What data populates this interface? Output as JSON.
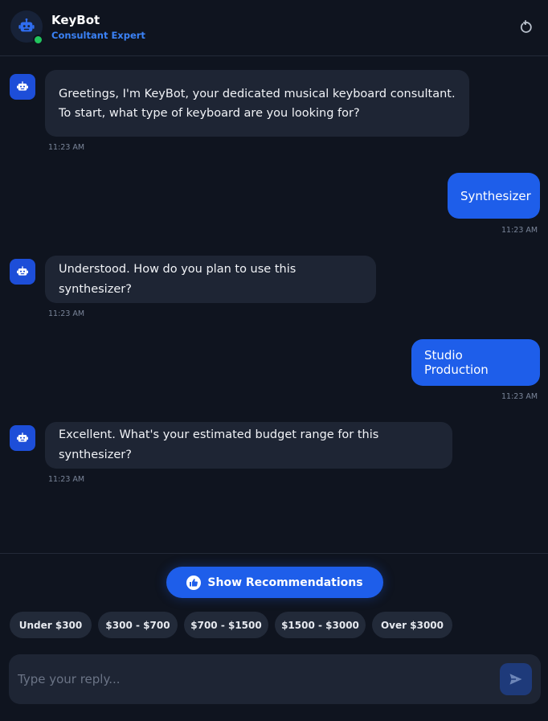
{
  "header": {
    "title": "KeyBot",
    "subtitle": "Consultant Expert"
  },
  "messages": [
    {
      "role": "bot",
      "lines": [
        "Greetings, I'm KeyBot, your dedicated musical keyboard consultant.",
        "To start, what type of keyboard are you looking for?"
      ],
      "time": "11:23 AM"
    },
    {
      "role": "user",
      "text": "Synthesizer",
      "time": "11:23 AM"
    },
    {
      "role": "bot",
      "lines": [
        "Understood. How do you plan to use this synthesizer?"
      ],
      "time": "11:23 AM"
    },
    {
      "role": "user",
      "text": "Studio Production",
      "time": "11:23 AM"
    },
    {
      "role": "bot",
      "lines": [
        "Excellent. What's your estimated budget range for this synthesizer?"
      ],
      "time": "11:23 AM"
    }
  ],
  "actions": {
    "recommend_label": "Show Recommendations"
  },
  "budget_options": [
    "Under $300",
    "$300 - $700",
    "$700 - $1500",
    "$1500 - $3000",
    "Over $3000"
  ],
  "composer": {
    "placeholder": "Type your reply...",
    "value": ""
  },
  "icons": {
    "avatar": "robot-icon",
    "reset": "refresh-icon",
    "recommend": "thumbs-up-icon",
    "send": "send-icon"
  },
  "colors": {
    "accent": "#1e5eea",
    "subtitle": "#3b82f6",
    "online": "#22c55e",
    "background": "#0f141f",
    "bot_bubble": "#1e2534"
  }
}
